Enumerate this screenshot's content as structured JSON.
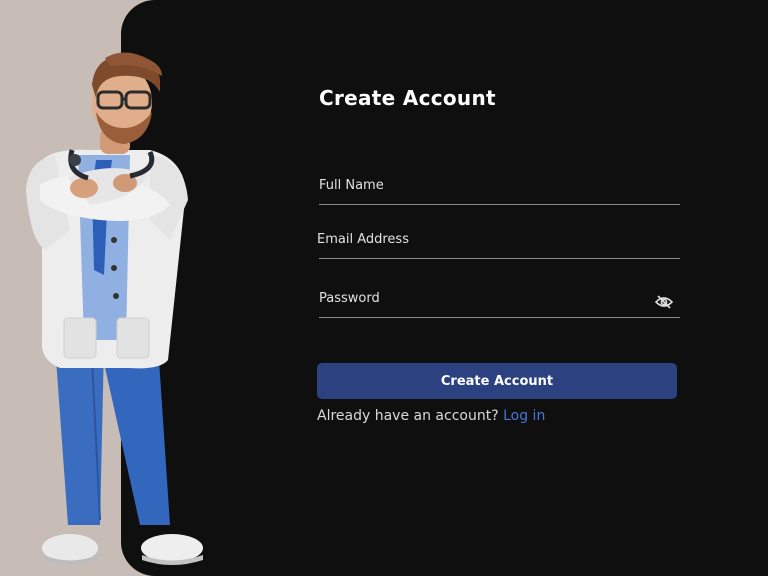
{
  "form": {
    "title": "Create Account",
    "full_name_placeholder": "Full Name",
    "email_placeholder": "Email Address",
    "password_placeholder": "Password",
    "submit_label": "Create Account",
    "login_prompt": "Already have an account?",
    "login_link": "Log in"
  },
  "illustration": {
    "icon": "doctor-illustration"
  },
  "colors": {
    "page_background": "#c8bcb6",
    "panel_background": "#0f0f10",
    "button_background": "#2c4180",
    "link": "#4a74d6"
  }
}
